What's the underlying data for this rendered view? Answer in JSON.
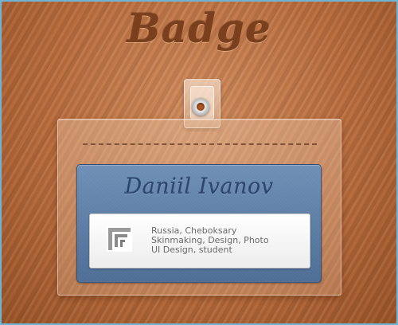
{
  "header": {
    "title": "Badge"
  },
  "badge": {
    "name": "Daniil Ivanov",
    "logo_icon": "ff-logo-icon",
    "info_lines": [
      "Russia, Cheboksary",
      "Skinmaking, Design, Photo",
      "UI Design, student"
    ]
  },
  "colors": {
    "wood": "#b96c3c",
    "title": "#7a3f1c",
    "card": "#5a7aa2",
    "name": "#2c4670",
    "info_text": "#6a6a6a",
    "frame_border": "#6fb3d6"
  }
}
